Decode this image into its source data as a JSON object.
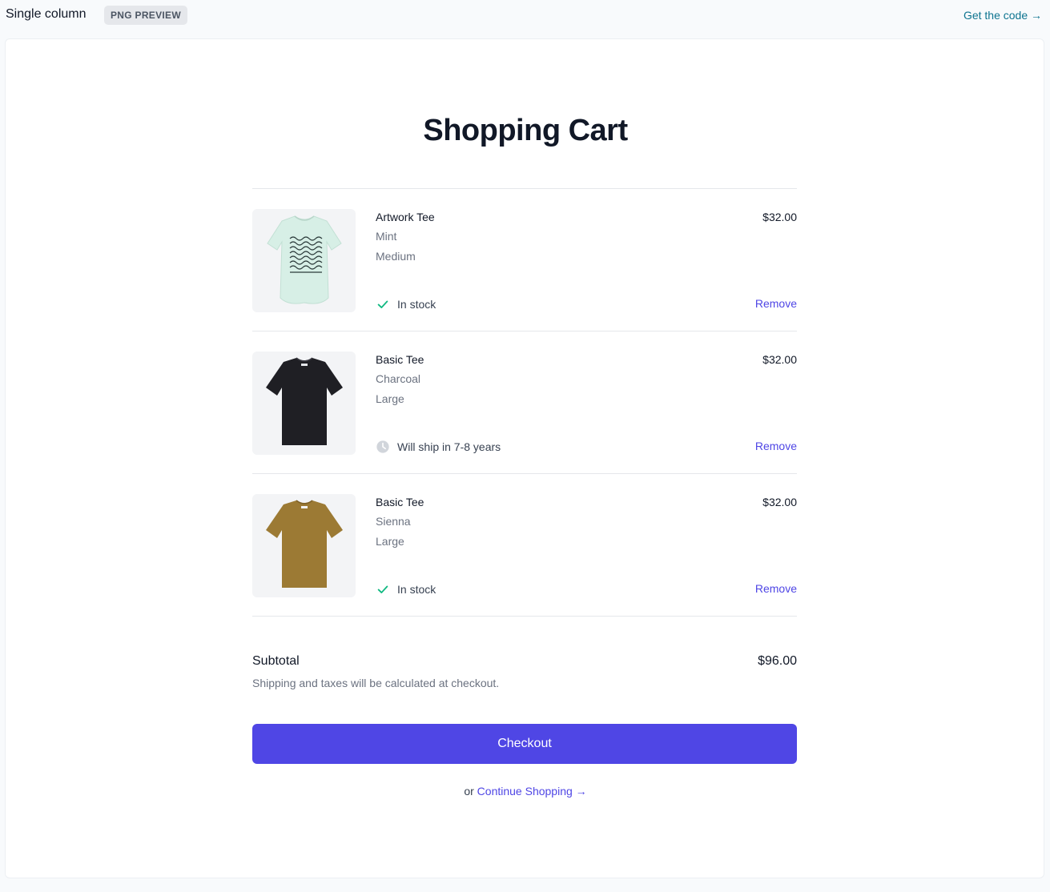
{
  "topbar": {
    "title": "Single column",
    "badge": "PNG PREVIEW",
    "get_code": "Get the code →"
  },
  "page": {
    "title": "Shopping Cart"
  },
  "cart": {
    "items": [
      {
        "name": "Artwork Tee",
        "color": "Mint",
        "size": "Medium",
        "price": "$32.00",
        "status": "In stock",
        "status_icon": "check-icon",
        "remove": "Remove",
        "shirt_color": "#d7efe6"
      },
      {
        "name": "Basic Tee",
        "color": "Charcoal",
        "size": "Large",
        "price": "$32.00",
        "status": "Will ship in 7-8 years",
        "status_icon": "clock-icon",
        "remove": "Remove",
        "shirt_color": "#1f1f24"
      },
      {
        "name": "Basic Tee",
        "color": "Sienna",
        "size": "Large",
        "price": "$32.00",
        "status": "In stock",
        "status_icon": "check-icon",
        "remove": "Remove",
        "shirt_color": "#9c7a34"
      }
    ]
  },
  "summary": {
    "subtotal_label": "Subtotal",
    "subtotal_value": "$96.00",
    "note": "Shipping and taxes will be calculated at checkout."
  },
  "actions": {
    "checkout": "Checkout",
    "or_text": "or",
    "continue_shopping": "Continue Shopping →"
  },
  "colors": {
    "accent": "#4f46e5",
    "success": "#10b981",
    "muted_icon": "#d1d5db"
  }
}
